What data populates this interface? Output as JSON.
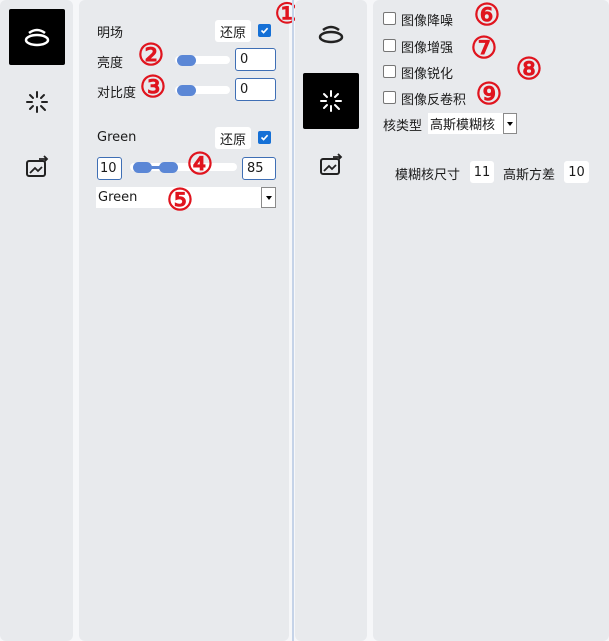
{
  "left_panel": {
    "section1": {
      "title": "明场",
      "reset_label": "还原",
      "checked": true
    },
    "brightness": {
      "label": "亮度",
      "value": "0"
    },
    "contrast": {
      "label": "对比度",
      "value": "0"
    },
    "channel": {
      "title": "Green",
      "reset_label": "还原",
      "checked": true,
      "min": "10",
      "max": "85",
      "select_value": "Green"
    }
  },
  "right_panel": {
    "options": [
      {
        "label": "图像降噪",
        "checked": false
      },
      {
        "label": "图像增强",
        "checked": false
      },
      {
        "label": "图像锐化",
        "checked": false
      },
      {
        "label": "图像反卷积",
        "checked": false
      }
    ],
    "kernel_type_label": "核类型",
    "kernel_type_value": "高斯模糊核",
    "kernel_size_label": "模糊核尺寸",
    "kernel_size_value": "11",
    "variance_label": "高斯方差",
    "variance_value": "10"
  },
  "annotations": [
    "①",
    "②",
    "③",
    "④",
    "⑤",
    "⑥",
    "⑦",
    "⑧",
    "⑨"
  ],
  "colors": {
    "accent": "#1570d6",
    "slider": "#5b87d6",
    "annotation": "#e0141e",
    "active_tool": "#000000"
  },
  "icons": [
    "brightfield-icon",
    "magic-wand-icon",
    "image-export-icon"
  ]
}
